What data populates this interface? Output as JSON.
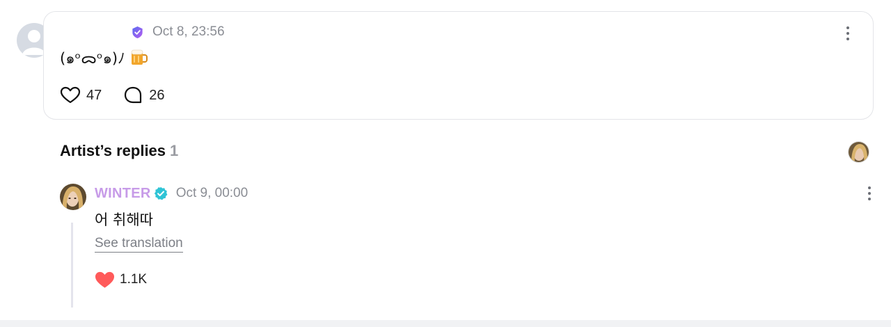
{
  "post": {
    "timestamp": "Oct 8, 23:56",
    "body_text": "(๑ᵒᯅᵒ๑)ﾉ",
    "likes": "47",
    "comments": "26"
  },
  "artist_replies": {
    "title": "Artist’s replies",
    "count": "1"
  },
  "reply": {
    "author": "WINTER",
    "timestamp": "Oct 9, 00:00",
    "body_text": "어 취해따",
    "translation_link": "See translation",
    "likes": "1.1K"
  },
  "colors": {
    "artist_name": "#c79be8",
    "verified_badge": "#2fc4d6",
    "liked_heart": "#ff5a5a",
    "card_border": "#e3e4e8",
    "muted_text": "#8a8d94"
  }
}
